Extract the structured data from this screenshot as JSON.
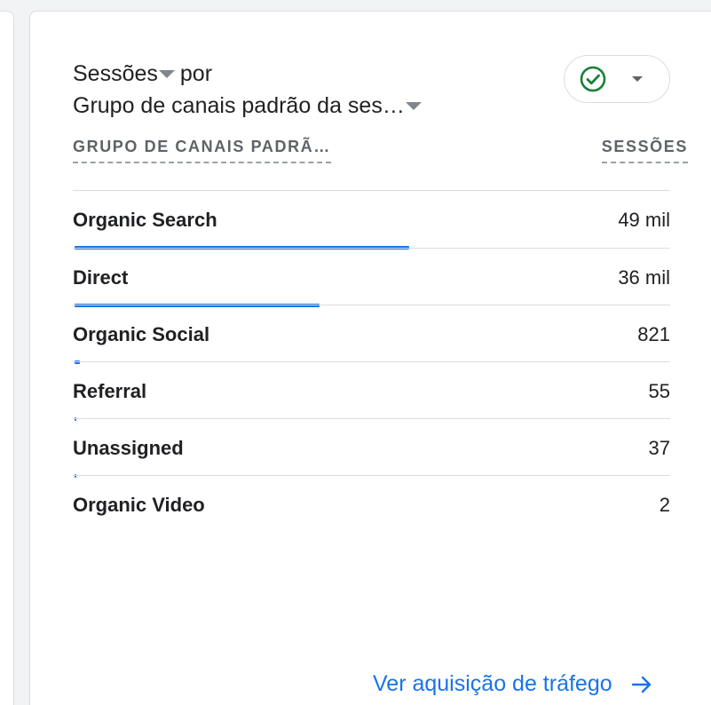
{
  "title": {
    "metric": "Sessões",
    "connector": "por",
    "dimension": "Grupo de canais padrão da ses…"
  },
  "status_icon": "check-circle-icon",
  "columns": {
    "dimension": "GRUPO DE CANAIS PADRÃ…",
    "metric": "SESSÕES"
  },
  "rows": [
    {
      "label": "Organic Search",
      "value": "49 mil",
      "share": 0.56
    },
    {
      "label": "Direct",
      "value": "36 mil",
      "share": 0.41
    },
    {
      "label": "Organic Social",
      "value": "821",
      "share": 0.009
    },
    {
      "label": "Referral",
      "value": "55",
      "share": 0.001
    },
    {
      "label": "Unassigned",
      "value": "37",
      "share": 0.001
    },
    {
      "label": "Organic Video",
      "value": "2",
      "share": 0
    }
  ],
  "footer": {
    "link_label": "Ver aquisição de tráfego",
    "icon": "arrow-right-icon"
  },
  "colors": {
    "accent": "#1a73e8",
    "status_green": "#188038"
  }
}
